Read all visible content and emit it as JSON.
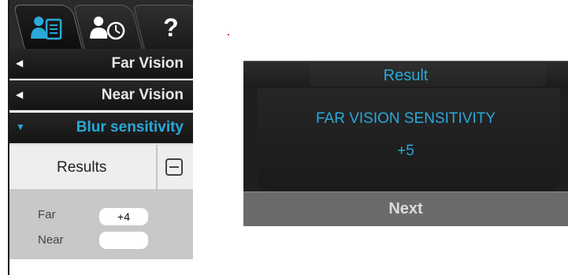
{
  "tabs": [
    {
      "icon": "patient-record-icon",
      "active": true
    },
    {
      "icon": "patient-history-icon",
      "active": false
    },
    {
      "icon": "help-icon",
      "glyph": "?",
      "active": false
    }
  ],
  "sections": [
    {
      "label": "Far Vision",
      "expanded": false
    },
    {
      "label": "Near Vision",
      "expanded": false
    },
    {
      "label": "Blur sensitivity",
      "expanded": true
    }
  ],
  "results": {
    "label": "Results",
    "rows": [
      {
        "label": "Far",
        "value": "+4"
      },
      {
        "label": "Near",
        "value": ""
      }
    ]
  },
  "dialog": {
    "title": "Result",
    "heading": "FAR VISION SENSITIVITY",
    "value": "+5",
    "next_label": "Next"
  },
  "colors": {
    "accent": "#2aa9d8",
    "panel_dark": "#1f1f1f",
    "results_bg": "#c8c8c8",
    "next_bg": "#6b6b6b"
  }
}
